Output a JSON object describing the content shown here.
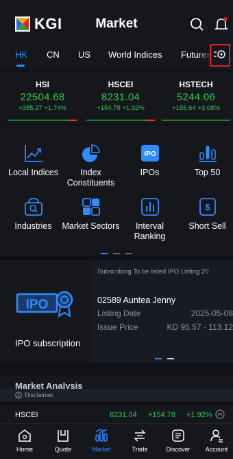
{
  "header": {
    "logo_text": "KGI",
    "title": "Market"
  },
  "tabs": [
    {
      "label": "HK",
      "active": true
    },
    {
      "label": "CN",
      "active": false
    },
    {
      "label": "US",
      "active": false
    },
    {
      "label": "World Indices",
      "active": false
    },
    {
      "label": "Futures",
      "active": false
    }
  ],
  "indices": [
    {
      "name": "HSI",
      "price": "22504.68",
      "change": "+385.27 +1.74%"
    },
    {
      "name": "HSCEI",
      "price": "8231.04",
      "change": "+154.78 +1.92%"
    },
    {
      "name": "HSTECH",
      "price": "5244.06",
      "change": "+156.64 +3.08%"
    }
  ],
  "functions": [
    {
      "label": "Local Indices",
      "icon": "chart-trend-icon"
    },
    {
      "label": "Index Constituents",
      "icon": "pie-chart-icon"
    },
    {
      "label": "IPOs",
      "icon": "ipo-icon"
    },
    {
      "label": "Top 50",
      "icon": "bar-ranking-icon"
    },
    {
      "label": "Industries",
      "icon": "industry-search-icon"
    },
    {
      "label": "Market Sectors",
      "icon": "sectors-grid-icon"
    },
    {
      "label": "Interval Ranking",
      "icon": "interval-chart-icon"
    },
    {
      "label": "Short Sell",
      "icon": "dollar-doc-icon"
    }
  ],
  "ipo": {
    "section_label": "IPO subscription",
    "subtabs": "Subscribing To be listed IPO Listing 20",
    "stock": "02589 Auntea Jenny",
    "listing_date_label": "Listing Date",
    "listing_date_value": "2025-05-08",
    "issue_price_label": "Issue Price",
    "issue_price_value": "KD 95.57 - 113.12"
  },
  "market_analysis": {
    "title": "Market Analysis"
  },
  "disclaimer": "Disclaimer",
  "ticker": {
    "name": "HSCEI",
    "price": "8231.04",
    "change": "+154.78",
    "pct": "+1.92%"
  },
  "nav": [
    {
      "label": "Home",
      "icon": "home-icon",
      "active": false
    },
    {
      "label": "Quote",
      "icon": "quote-icon",
      "active": false
    },
    {
      "label": "Market",
      "icon": "market-icon",
      "active": true
    },
    {
      "label": "Trade",
      "icon": "trade-icon",
      "active": false
    },
    {
      "label": "Discover",
      "icon": "discover-icon",
      "active": false
    },
    {
      "label": "Account",
      "icon": "account-icon",
      "active": false
    }
  ],
  "colors": {
    "accent": "#2f8cff",
    "up": "#2cc94a",
    "down": "#d83a3a",
    "highlight_box": "#e0202a",
    "background": "#0f1116"
  }
}
